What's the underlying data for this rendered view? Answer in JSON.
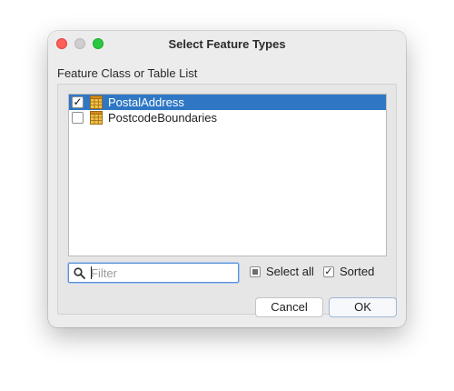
{
  "window": {
    "title": "Select Feature Types"
  },
  "main": {
    "section_label": "Feature Class or Table List",
    "items": [
      {
        "label": "PostalAddress",
        "checked": true,
        "selected": true,
        "icon": "table-icon"
      },
      {
        "label": "PostcodeBoundaries",
        "checked": false,
        "selected": false,
        "icon": "table-icon"
      }
    ],
    "filter": {
      "value": "",
      "placeholder": "Filter",
      "icon": "search-icon"
    },
    "select_all": {
      "label": "Select all",
      "state": "partial"
    },
    "sorted": {
      "label": "Sorted",
      "checked": true
    }
  },
  "buttons": {
    "cancel": "Cancel",
    "ok": "OK"
  },
  "colors": {
    "selection": "#2f77c5",
    "close": "#fe5f57",
    "maximize": "#28c840",
    "focus_ring": "#5a90d6"
  }
}
